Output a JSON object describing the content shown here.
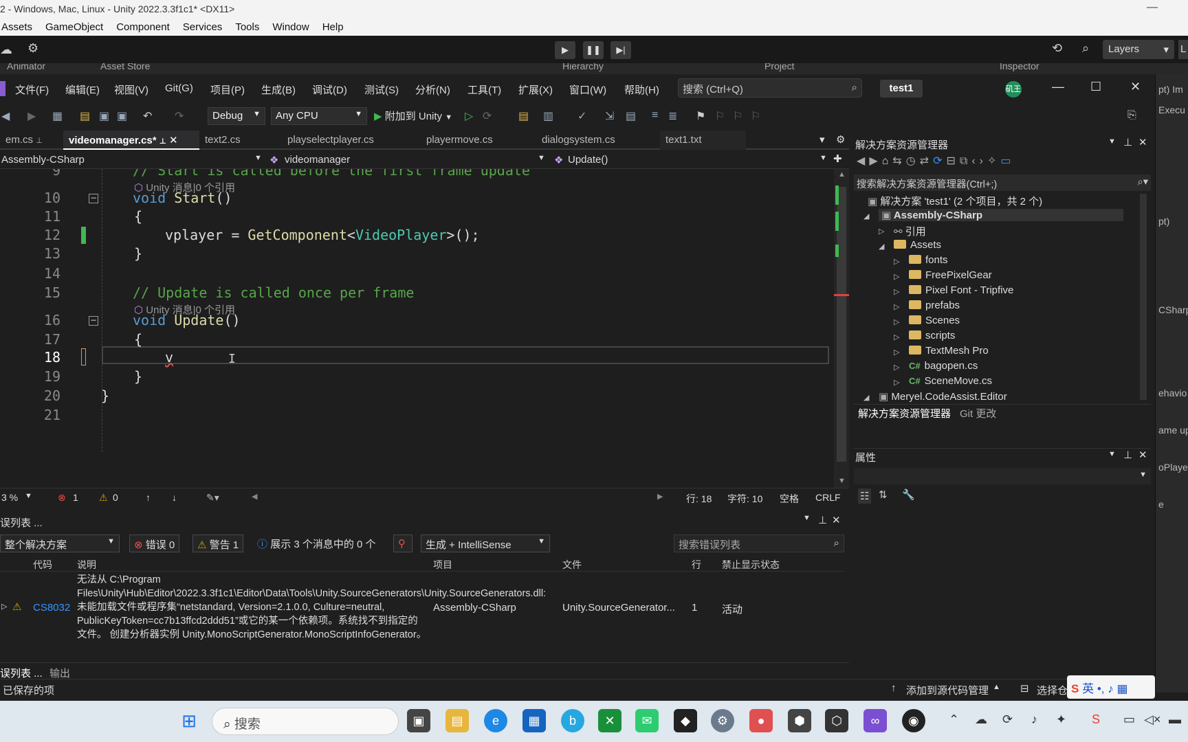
{
  "unity": {
    "title": "2 - Windows, Mac, Linux - Unity 2022.3.3f1c1* <DX11>",
    "menu": [
      "Assets",
      "GameObject",
      "Component",
      "Services",
      "Tools",
      "Window",
      "Help"
    ],
    "layers_label": "Layers",
    "layout_short": "L",
    "tabs": [
      "Animator",
      "Asset Store",
      "Hierarchy",
      "Project",
      "Inspector"
    ],
    "right_snippets": [
      "pt) Im",
      "Execu",
      "pt)",
      "CSharp",
      "ehavio",
      "ame up",
      "oPlaye",
      "e"
    ]
  },
  "vs": {
    "menu": [
      "文件(F)",
      "编辑(E)",
      "视图(V)",
      "Git(G)",
      "项目(P)",
      "生成(B)",
      "调试(D)",
      "测试(S)",
      "分析(N)",
      "工具(T)",
      "扩展(X)",
      "窗口(W)",
      "帮助(H)"
    ],
    "search_placeholder": "搜索 (Ctrl+Q)",
    "solution_name": "test1",
    "avatar": "矶王",
    "toolbar": {
      "config": "Debug",
      "platform": "Any CPU",
      "attach": "附加到 Unity"
    },
    "doc_tabs": [
      "em.cs",
      "videomanager.cs*",
      "text2.cs",
      "playselectplayer.cs",
      "playermove.cs",
      "dialogsystem.cs",
      "text1.txt"
    ],
    "nav": {
      "project": "Assembly-CSharp",
      "class": "videomanager",
      "member": "Update()"
    },
    "code_lines": [
      {
        "n": "9",
        "text": "// Start is called before the first frame update"
      },
      {
        "n": "",
        "lens": "Unity 消息|0 个引用"
      },
      {
        "n": "10",
        "text": "void Start()"
      },
      {
        "n": "11",
        "text": "{"
      },
      {
        "n": "12",
        "text": "vplayer = GetComponent<VideoPlayer>();"
      },
      {
        "n": "13",
        "text": "}"
      },
      {
        "n": "14",
        "text": ""
      },
      {
        "n": "15",
        "text": "// Update is called once per frame"
      },
      {
        "n": "",
        "lens": "Unity 消息|0 个引用"
      },
      {
        "n": "16",
        "text": "void Update()"
      },
      {
        "n": "17",
        "text": "{"
      },
      {
        "n": "18",
        "text": "v"
      },
      {
        "n": "19",
        "text": "}"
      },
      {
        "n": "20",
        "text": "}"
      },
      {
        "n": "21",
        "text": ""
      }
    ],
    "status_strip": {
      "zoom": "3 %",
      "errors": "1",
      "warnings": "0",
      "line": "行: 18",
      "col": "字符: 10",
      "spaces": "空格",
      "eol": "CRLF"
    },
    "error_list": {
      "title": "误列表 ...",
      "scope": "整个解决方案",
      "errors_btn": "错误 0",
      "warnings_btn": "警告 1",
      "messages_btn": "展示 3 个消息中的 0 个",
      "source": "生成 + IntelliSense",
      "search_placeholder": "搜索错误列表",
      "columns": [
        "代码",
        "说明",
        "项目",
        "文件",
        "行",
        "禁止显示状态"
      ],
      "row": {
        "code": "CS8032",
        "description": "无法从 C:\\Program Files\\Unity\\Hub\\Editor\\2022.3.3f1c1\\Editor\\Data\\Tools\\Unity.SourceGenerators\\Unity.SourceGenerators.dll: 未能加载文件或程序集“netstandard, Version=2.1.0.0, Culture=neutral, PublicKeyToken=cc7b13ffcd2ddd51”或它的某一个依赖项。系统找不到指定的文件。 创建分析器实例 Unity.MonoScriptGenerator.MonoScriptInfoGenerator。",
        "project": "Assembly-CSharp",
        "file": "Unity.SourceGenerator...",
        "line": "1",
        "state": "活动"
      },
      "bottom_tabs": [
        "误列表 ...",
        "输出"
      ]
    },
    "solution_explorer": {
      "title": "解决方案资源管理器",
      "search": "搜索解决方案资源管理器(Ctrl+;)",
      "solution": "解决方案 'test1' (2 个项目，共 2 个)",
      "items": [
        {
          "label": "Assembly-CSharp",
          "level": 1,
          "kind": "project",
          "bold": true
        },
        {
          "label": "引用",
          "level": 2,
          "kind": "refs"
        },
        {
          "label": "Assets",
          "level": 2,
          "kind": "folder"
        },
        {
          "label": "fonts",
          "level": 3,
          "kind": "folder"
        },
        {
          "label": "FreePixelGear",
          "level": 3,
          "kind": "folder"
        },
        {
          "label": "Pixel Font - Tripfive",
          "level": 3,
          "kind": "folder"
        },
        {
          "label": "prefabs",
          "level": 3,
          "kind": "folder"
        },
        {
          "label": "Scenes",
          "level": 3,
          "kind": "folder"
        },
        {
          "label": "scripts",
          "level": 3,
          "kind": "folder"
        },
        {
          "label": "TextMesh Pro",
          "level": 3,
          "kind": "folder"
        },
        {
          "label": "bagopen.cs",
          "level": 3,
          "kind": "cs"
        },
        {
          "label": "SceneMove.cs",
          "level": 3,
          "kind": "cs"
        },
        {
          "label": "Meryel.CodeAssist.Editor",
          "level": 1,
          "kind": "project"
        }
      ],
      "bottom_tabs": [
        "解决方案资源管理器",
        "Git 更改"
      ]
    },
    "properties_title": "属性",
    "status": {
      "left": "已保存的项",
      "source_control": "添加到源代码管理",
      "select": "选择仓"
    }
  },
  "taskbar": {
    "search_placeholder": "搜索",
    "tray_lang": "英"
  }
}
